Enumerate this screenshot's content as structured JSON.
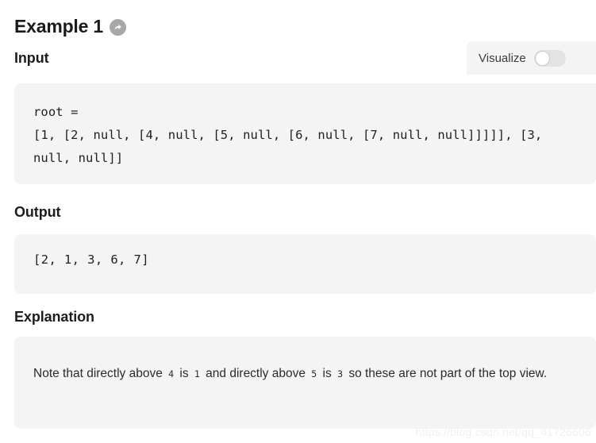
{
  "example": {
    "title": "Example 1",
    "share_icon": "share-arrow-icon"
  },
  "visualize": {
    "label": "Visualize",
    "toggle_state": "off",
    "track_color": "#e3e3e5",
    "knob_color": "#ffffff"
  },
  "sections": {
    "input": {
      "label": "Input",
      "code": "root =\n[1, [2, null, [4, null, [5, null, [6, null, [7, null, null]]]]], [3, null, null]]"
    },
    "output": {
      "label": "Output",
      "code": "[2, 1, 3, 6, 7]"
    },
    "explanation": {
      "label": "Explanation",
      "text_parts": {
        "p1": "Note that directly above",
        "c1": "4",
        "p2": "is",
        "c2": "1",
        "p3": "and directly above",
        "c3": "5",
        "p4": "is",
        "c4": "3",
        "p5": "so these are not part of the top view."
      }
    }
  },
  "watermark": {
    "text": "https://blog.csdn.net/qq_41726606"
  },
  "colors": {
    "page_background": "#ffffff",
    "panel_background": "#f4f4f5",
    "text_primary": "#1d1d1d",
    "icon_gray": "#a8a8a8"
  }
}
